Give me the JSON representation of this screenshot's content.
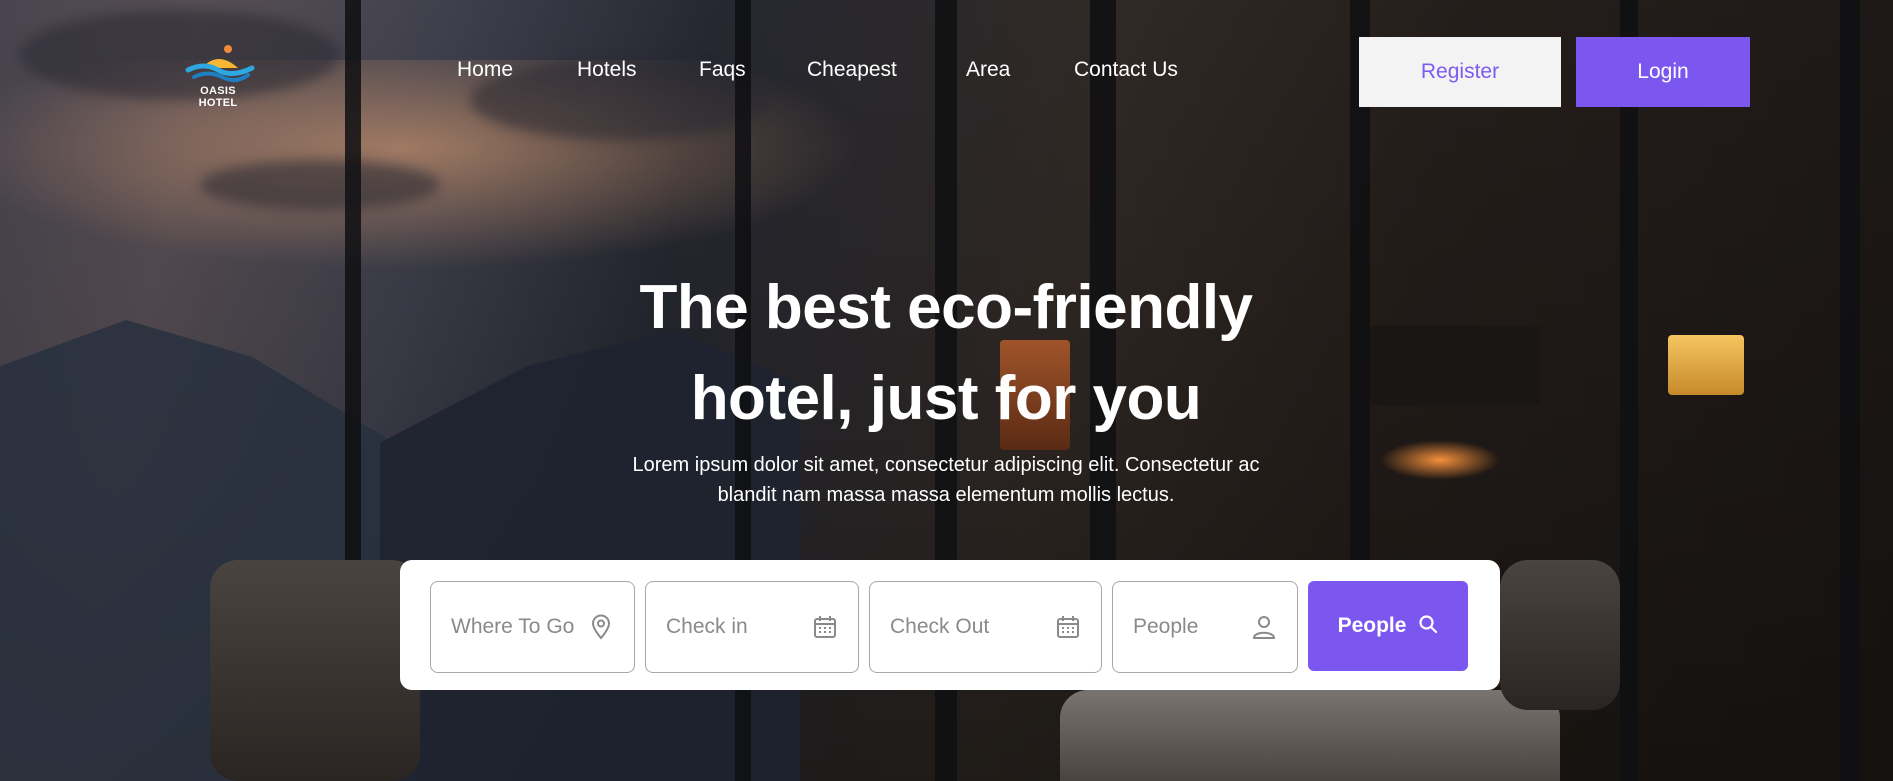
{
  "brand": {
    "name": "OASIS HOTEL"
  },
  "nav": {
    "items": [
      "Home",
      "Hotels",
      "Faqs",
      "Cheapest",
      "Area",
      "Contact Us"
    ]
  },
  "auth": {
    "register_label": "Register",
    "login_label": "Login"
  },
  "hero": {
    "headline_line1": "The best eco-friendly",
    "headline_line2": "hotel, just for you",
    "subtext_line1": "Lorem ipsum dolor sit amet, consectetur adipiscing elit. Consectetur ac",
    "subtext_line2": "blandit nam massa massa elementum mollis lectus."
  },
  "search": {
    "destination_placeholder": "Where To Go",
    "checkin_placeholder": "Check in",
    "checkout_placeholder": "Check Out",
    "people_placeholder": "People",
    "submit_label": "People"
  },
  "icons": {
    "destination": "map-pin-icon",
    "checkin": "calendar-icon",
    "checkout": "calendar-icon",
    "people": "user-icon",
    "submit": "search-icon"
  },
  "colors": {
    "accent": "#7b57f0",
    "register_text": "#7b5cf0",
    "register_bg": "#f3f3f3"
  }
}
